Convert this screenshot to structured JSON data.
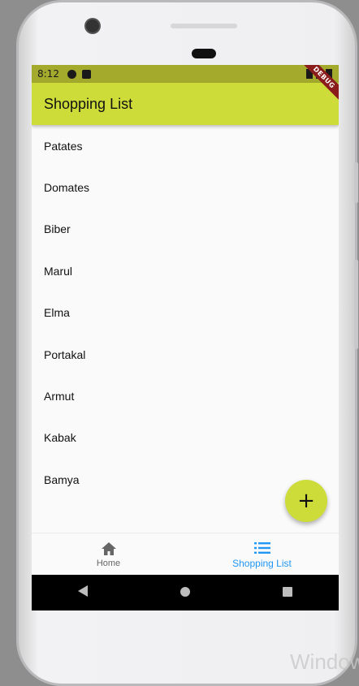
{
  "status_bar": {
    "time": "8:12"
  },
  "debug_banner": "DEBUG",
  "app_bar": {
    "title": "Shopping List"
  },
  "shopping_list": {
    "items": [
      "Patates",
      "Domates",
      "Biber",
      "Marul",
      "Elma",
      "Portakal",
      "Armut",
      "Kabak",
      "Bamya"
    ]
  },
  "fab": {
    "symbol": "+"
  },
  "bottom_nav": {
    "items": [
      {
        "label": "Home",
        "icon": "home-icon",
        "active": false
      },
      {
        "label": "Shopping List",
        "icon": "list-icon",
        "active": true
      }
    ]
  },
  "colors": {
    "primary": "#cddc39",
    "status_bar": "#a3aa2c",
    "active_nav": "#2196f3",
    "inactive_nav": "#666666"
  },
  "watermark": "Window"
}
